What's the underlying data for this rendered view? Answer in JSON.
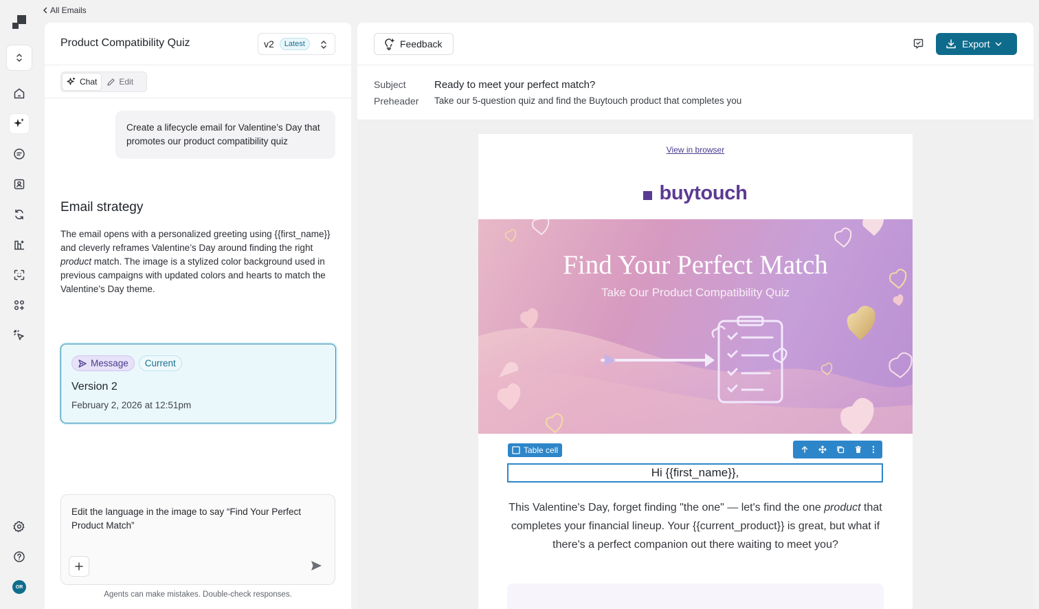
{
  "nav": {
    "back_label": "All Emails",
    "icons": [
      "logo-icon",
      "workspace-switch-icon",
      "home-icon",
      "ai-sparkle-icon",
      "campaigns-icon",
      "contacts-icon",
      "automation-icon",
      "analytics-icon",
      "audience-icon",
      "apps-icon",
      "click-tracking-icon",
      "settings-icon",
      "help-icon"
    ],
    "avatar_initials": "OR"
  },
  "left_panel": {
    "title": "Product Compatibility Quiz",
    "version": "v2",
    "version_badge": "Latest",
    "tabs": [
      {
        "label": "Chat",
        "active": true
      },
      {
        "label": "Edit",
        "active": false
      }
    ],
    "user_message": "Create a lifecycle email for Valentine’s Day that promotes our product compatibility quiz",
    "strategy_title": "Email strategy",
    "strategy_body": {
      "part1": "The email opens with a personalized greeting using {{first_name}} and cleverly reframes Valentine’s Day around finding the right ",
      "emphasis": "product",
      "part2": " match. The image is a stylized color background used in previous campaigns with updated colors and hearts to match the Valentine’s Day theme."
    },
    "version_card": {
      "tag_message": "Message",
      "tag_current": "Current",
      "title": "Version 2",
      "date": "February 2, 2026 at 12:51pm"
    },
    "composer_text": "Edit the language in the image to say “Find Your Perfect Product Match”",
    "disclaimer": "Agents can make mistakes. Double-check responses."
  },
  "right_panel": {
    "feedback_label": "Feedback",
    "export_label": "Export",
    "subject_label": "Subject",
    "subject_value": "Ready to meet your perfect match?",
    "preheader_label": "Preheader",
    "preheader_value": "Take our 5-question quiz and find the Buytouch product that completes you"
  },
  "email": {
    "view_in_browser": "View in browser",
    "brand": "buytouch",
    "hero_title": "Find Your Perfect Match",
    "hero_subtitle": "Take Our Product Compatibility Quiz",
    "selection_tag": "Table cell",
    "greeting": "Hi {{first_name}},",
    "body": {
      "part1": "This Valentine's Day, forget finding \"the one\" — let's find the one ",
      "emphasis": "product",
      "part2": " that completes your financial lineup. Your {{current_product}} is great, but what if there's a perfect companion out there waiting to meet you?"
    }
  },
  "colors": {
    "accent": "#0e6b8c",
    "brand_purple": "#5b3a93",
    "selection_blue": "#2d86c9"
  }
}
